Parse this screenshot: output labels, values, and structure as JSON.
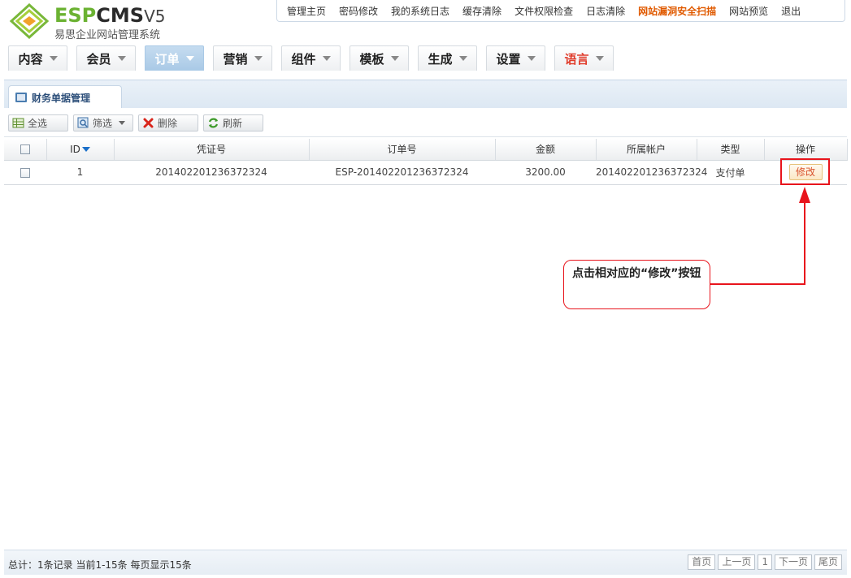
{
  "brand": {
    "logo_esp": "ESP",
    "logo_cms": "CMS",
    "logo_ver": "V5",
    "subtitle": "易思企业网站管理系统"
  },
  "topnav": [
    {
      "label": "管理主页"
    },
    {
      "label": "密码修改"
    },
    {
      "label": "我的系统日志"
    },
    {
      "label": "缓存清除"
    },
    {
      "label": "文件权限检查"
    },
    {
      "label": "日志清除"
    },
    {
      "label": "网站漏洞安全扫描"
    },
    {
      "label": "网站预览"
    },
    {
      "label": "退出"
    }
  ],
  "mainnav": [
    {
      "label": "内容"
    },
    {
      "label": "会员"
    },
    {
      "label": "订单"
    },
    {
      "label": "营销"
    },
    {
      "label": "组件"
    },
    {
      "label": "模板"
    },
    {
      "label": "生成"
    },
    {
      "label": "设置"
    },
    {
      "label": "语言"
    }
  ],
  "panel": {
    "title": "财务单据管理"
  },
  "toolbar": {
    "select_all": "全选",
    "filter": "筛选",
    "delete": "删除",
    "refresh": "刷新"
  },
  "table": {
    "headers": [
      "ID",
      "凭证号",
      "订单号",
      "金额",
      "所属帐户",
      "类型",
      "操作"
    ],
    "rows": [
      {
        "id": "1",
        "voucher": "201402201236372324",
        "order": "ESP-201402201236372324",
        "amount": "3200.00",
        "account": "201402201236372324",
        "type": "支付单",
        "action": "修改"
      }
    ]
  },
  "callout": {
    "text": "点击相对应的“修改”按钮"
  },
  "footer": {
    "summary": "总计：1条记录 当前1-15条 每页显示15条",
    "pager": [
      "首页",
      "上一页",
      "1",
      "下一页",
      "尾页"
    ]
  },
  "colors": {
    "accent": "#a9c9e6",
    "highlight": "#e8141c",
    "hot_link": "#e05a00"
  }
}
